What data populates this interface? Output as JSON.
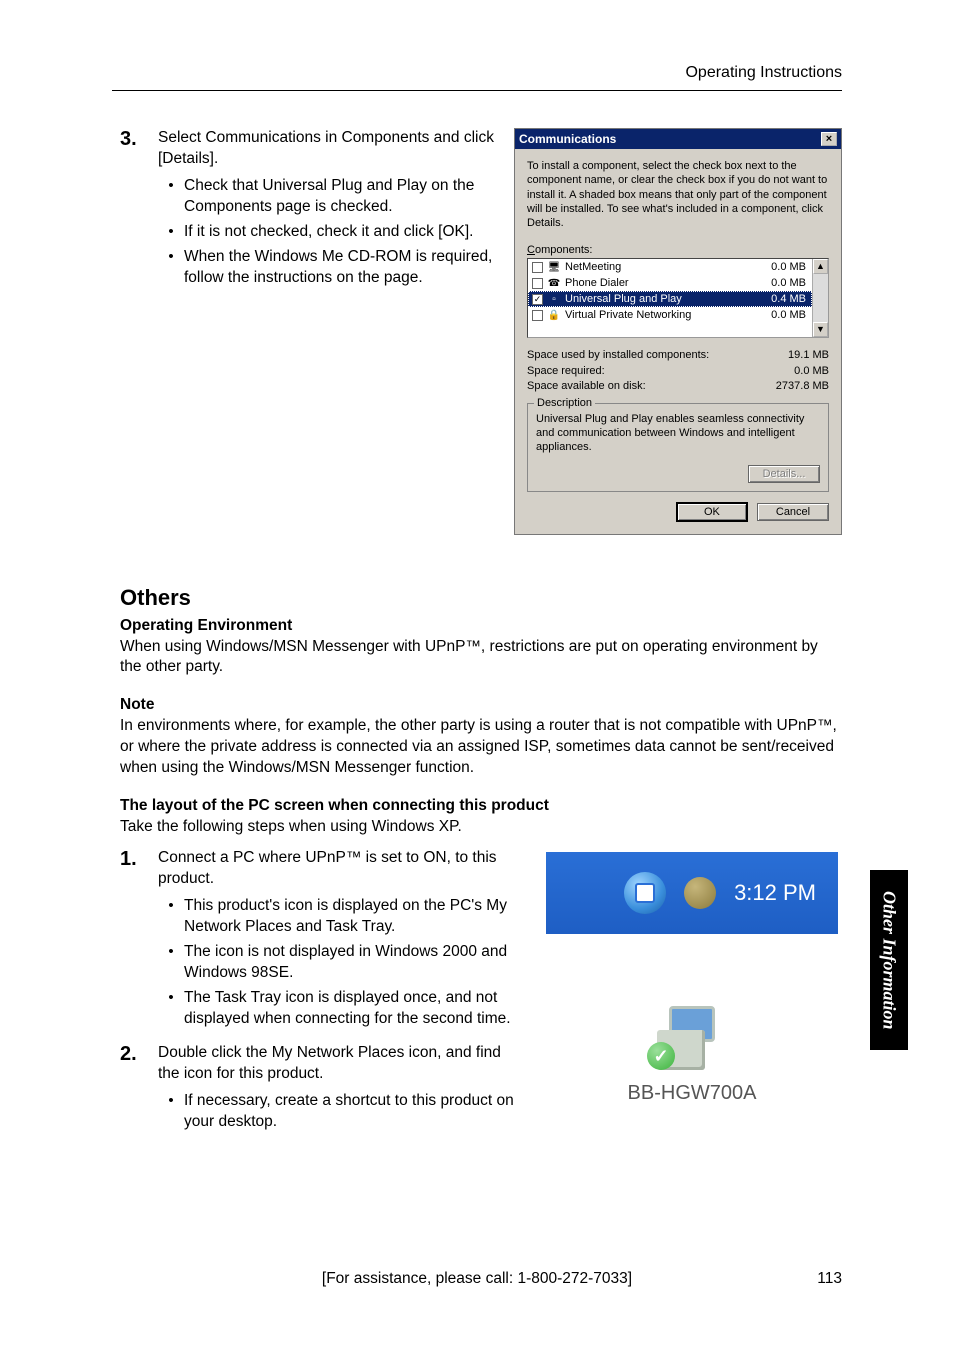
{
  "header": {
    "right": "Operating Instructions"
  },
  "step3": {
    "num": "3.",
    "text": "Select Communications in Components and click [Details].",
    "bullets": [
      "Check that Universal Plug and Play on the Components page is checked.",
      "If it is not checked, check it and click [OK].",
      "When the Windows Me CD-ROM is required, follow the instructions on the page."
    ]
  },
  "dialog": {
    "title": "Communications",
    "close": "×",
    "desc": "To install a component, select the check box next to the component name, or clear the check box if you do not want to install it. A shaded box means that only part of the component will be installed. To see what's included in a component, click Details.",
    "components_label_u": "C",
    "components_label_rest": "omponents:",
    "rows": [
      {
        "checked": false,
        "icon": "🖥",
        "name": "NetMeeting",
        "size": "0.0 MB",
        "hl": false
      },
      {
        "checked": false,
        "icon": "☎",
        "name": "Phone Dialer",
        "size": "0.0 MB",
        "hl": false
      },
      {
        "checked": true,
        "icon": "▫",
        "name": "Universal Plug and Play",
        "size": "0.4 MB",
        "hl": true
      },
      {
        "checked": false,
        "icon": "🔒",
        "name": "Virtual Private Networking",
        "size": "0.0 MB",
        "hl": false
      }
    ],
    "scroll_up": "▲",
    "scroll_down": "▼",
    "space": [
      {
        "label": "Space used by installed components:",
        "value": "19.1 MB"
      },
      {
        "label": "Space required:",
        "value": "0.0 MB"
      },
      {
        "label": "Space available on disk:",
        "value": "2737.8 MB"
      }
    ],
    "fieldset": {
      "legend": "Description",
      "text": "Universal Plug and Play enables seamless connectivity and communication between Windows and intelligent appliances.",
      "details": "Details..."
    },
    "ok": "OK",
    "cancel": "Cancel"
  },
  "others": {
    "heading": "Others",
    "env_h": "Operating Environment",
    "env_p": "When using Windows/MSN Messenger with UPnP™, restrictions are put on operating environment by the other party.",
    "note_h": "Note",
    "note_p": "In environments where, for example, the other party is using a router that is not compatible with UPnP™, or where the private address is connected via an assigned ISP, sometimes data cannot be sent/received when using the Windows/MSN Messenger function.",
    "layout_h": "The layout of the PC screen when connecting this product",
    "layout_p": "Take the following steps when using Windows XP."
  },
  "step1": {
    "num": "1.",
    "text": "Connect a PC where UPnP™ is set to ON, to this product.",
    "bullets": [
      "This product's icon is displayed on the PC's My Network Places and Task Tray.",
      "The icon is not displayed in Windows 2000 and Windows 98SE.",
      "The Task Tray icon is displayed once, and not displayed when connecting for the second time."
    ]
  },
  "step2": {
    "num": "2.",
    "text": "Double click the My Network Places icon, and find the icon for this product.",
    "bullets": [
      "If necessary, create a shortcut to this product on your desktop."
    ]
  },
  "tray": {
    "time": "3:12 PM"
  },
  "device": {
    "label": "BB-HGW700A",
    "tick": "✓"
  },
  "sidetab": "Other Information",
  "footer": {
    "assist": "[For assistance, please call: 1-800-272-7033]",
    "page": "113"
  }
}
